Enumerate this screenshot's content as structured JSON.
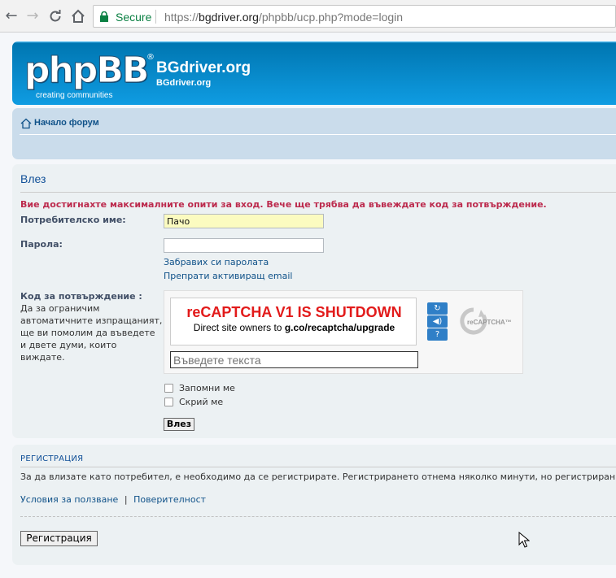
{
  "browser": {
    "secure_label": "Secure",
    "url_scheme": "https://",
    "url_host": "bgdriver.org",
    "url_path": "/phpbb/ucp.php?mode=login"
  },
  "header": {
    "logo_text": "phpBB",
    "logo_reg": "®",
    "logo_tagline": "creating communities",
    "site_name": "BGdriver.org",
    "site_description": "BGdriver.org"
  },
  "navbar": {
    "breadcrumb": "Начало форум"
  },
  "login": {
    "title": "Влез",
    "error": "Вие достигнахте максималните опити за вход. Вече ще трябва да въвеждате код за потвърждение.",
    "username_label": "Потребителско име:",
    "username_value": "Пачо",
    "password_label": "Парола:",
    "forgot_link": "Забравих си паролата",
    "resend_link": "Препрати активиращ email",
    "code_label": "Код за потвърждение :",
    "code_description": "Да за ограничим автоматичните изпращаният, ще ви помолим да въведете и двете думи, които виждате.",
    "captcha_title": "reCAPTCHA V1 IS SHUTDOWN",
    "captcha_sub_prefix": "Direct site owners to ",
    "captcha_sub_link": "g.co/recaptcha/upgrade",
    "captcha_placeholder": "Въведете текста",
    "captcha_logo_text": "reCAPTCHA™",
    "remember_label": "Запомни ме",
    "hide_label": "Скрий ме",
    "submit_label": "Влез"
  },
  "registration": {
    "title": "РЕГИСТРАЦИЯ",
    "text": "За да влизате като потребител, е необходимо да се регистрирате. Регистрирането отнема няколко минути, но регистрираните по",
    "terms_link": "Условия за ползване",
    "separator": "|",
    "privacy_link": "Поверителност",
    "button_label": "Регистрация"
  }
}
